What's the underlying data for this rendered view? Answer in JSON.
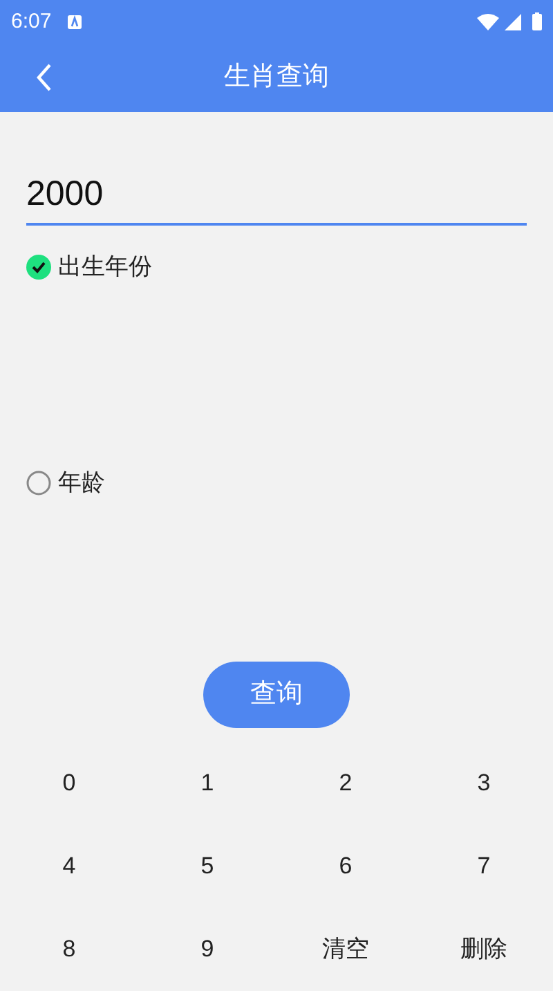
{
  "status_bar": {
    "time": "6:07"
  },
  "app_bar": {
    "title": "生肖查询"
  },
  "input": {
    "value": "2000"
  },
  "options": [
    {
      "label": "出生年份",
      "selected": true
    },
    {
      "label": "年龄",
      "selected": false
    }
  ],
  "query_button": "查询",
  "keypad": [
    "0",
    "1",
    "2",
    "3",
    "4",
    "5",
    "6",
    "7",
    "8",
    "9",
    "清空",
    "删除"
  ]
}
